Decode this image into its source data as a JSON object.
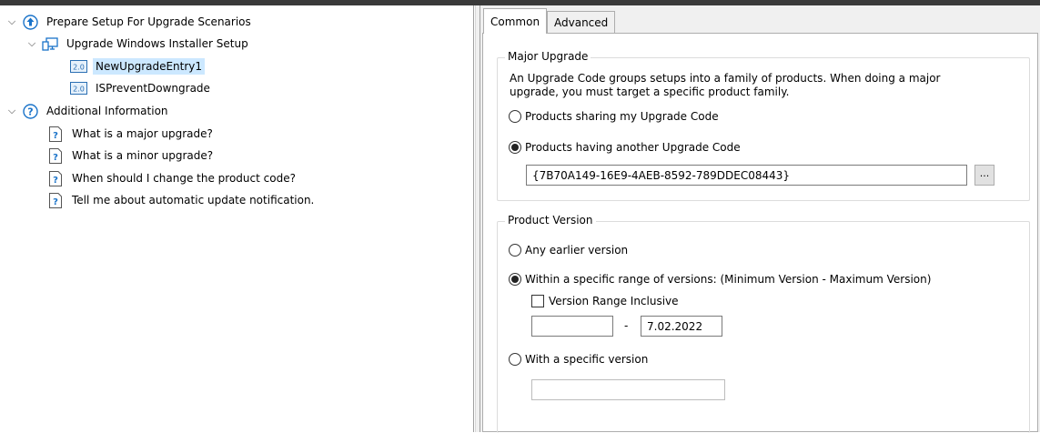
{
  "tree": {
    "root1": {
      "label": "Prepare Setup For Upgrade Scenarios",
      "icon": "upgrade-arrow-icon"
    },
    "child1": {
      "label": "Upgrade Windows Installer Setup",
      "icon": "computer-icon"
    },
    "leaves": [
      {
        "label": "NewUpgradeEntry1",
        "badge": "2.0",
        "selected": true
      },
      {
        "label": "ISPreventDowngrade",
        "badge": "2.0",
        "selected": false
      }
    ],
    "root2": {
      "label": "Additional Information",
      "icon": "help-circle-icon"
    },
    "help_items": [
      {
        "label": "What is a major upgrade?",
        "badge": "?"
      },
      {
        "label": "What is a minor upgrade?",
        "badge": "?"
      },
      {
        "label": "When should I change the product code?",
        "badge": "?"
      },
      {
        "label": "Tell me about automatic update notification.",
        "badge": "?"
      }
    ]
  },
  "tabs": [
    {
      "label": "Common",
      "active": true
    },
    {
      "label": "Advanced",
      "active": false
    }
  ],
  "major_upgrade": {
    "title": "Major Upgrade",
    "desc_line1": "An Upgrade Code groups setups into a family of products.  When doing a major",
    "desc_line2": "upgrade, you must target a specific product family.",
    "option_sharing": "Products sharing my Upgrade Code",
    "option_another": "Products having another Upgrade Code",
    "selected_option": "another",
    "upgrade_code": "{7B70A149-16E9-4AEB-8592-789DDEC08443}",
    "browse_label": "..."
  },
  "product_version": {
    "title": "Product Version",
    "option_any": "Any earlier version",
    "option_range": "Within a specific range of versions: (Minimum Version - Maximum Version)",
    "option_specific": "With a specific version",
    "selected_option": "range",
    "inclusive_label": "Version Range Inclusive",
    "inclusive_checked": false,
    "min_version": "",
    "separator": "-",
    "max_version": "7.02.2022",
    "specific_version": ""
  },
  "colors": {
    "selection": "#cce8ff",
    "accent_blue": "#1a73c9",
    "panel_bg": "#f0f0f0"
  }
}
